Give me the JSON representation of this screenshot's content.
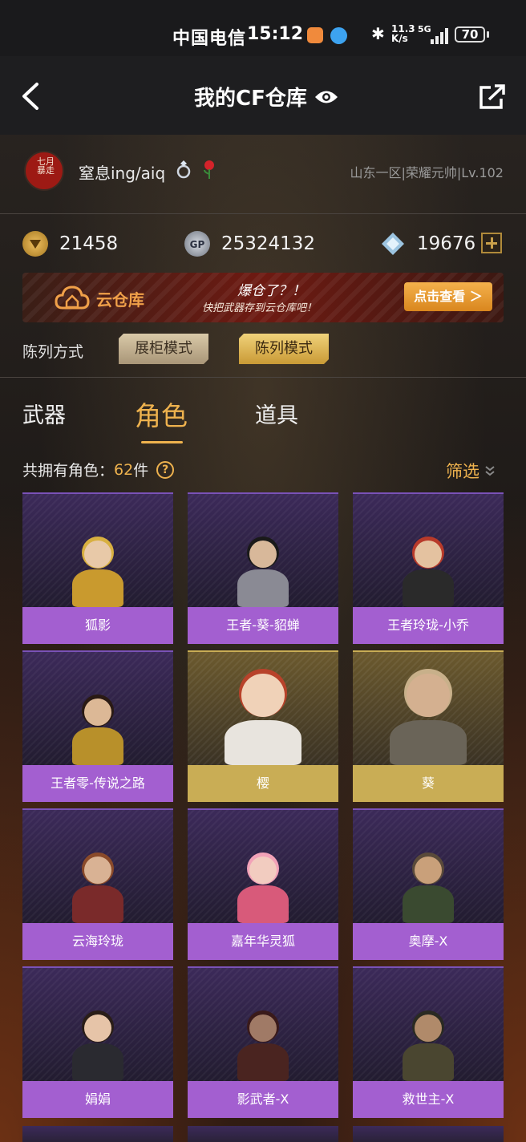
{
  "status_bar": {
    "carrier": "中国电信",
    "time": "15:12",
    "net_speed_value": "11.3",
    "net_speed_unit": "K/s",
    "network": "5G",
    "battery": "70"
  },
  "nav": {
    "title": "我的CF仓库"
  },
  "profile": {
    "username": "窒息ing/aiq",
    "server_rank": "山东一区|荣耀元帅|Lv.102",
    "avatar_text": "七月暴走"
  },
  "currencies": [
    {
      "icon": "cf-coin-icon",
      "value": "21458",
      "color": "#c99a36"
    },
    {
      "icon": "gp-icon",
      "value": "25324132",
      "color": "#8a8f99"
    },
    {
      "icon": "diamond-icon",
      "value": "19676",
      "color": "#7aa6c8"
    }
  ],
  "cloud_banner": {
    "label": "云仓库",
    "slogan_main": "爆仓了？！",
    "slogan_sub": "快把武器存到云仓库吧！",
    "button": "点击查看 ＞"
  },
  "display_mode": {
    "label": "陈列方式",
    "showcase": "展柜模式",
    "list": "陈列模式"
  },
  "tabs": [
    {
      "label": "武器",
      "active": false
    },
    {
      "label": "角色",
      "active": true
    },
    {
      "label": "道具",
      "active": false
    }
  ],
  "count": {
    "prefix": "共拥有角色：",
    "number": "62",
    "suffix": "件",
    "help": "?"
  },
  "filter": {
    "label": "筛选"
  },
  "characters": [
    {
      "name": "狐影",
      "rarity": "purple"
    },
    {
      "name": "王者-葵-貂蝉",
      "rarity": "purple"
    },
    {
      "name": "王者玲珑-小乔",
      "rarity": "purple"
    },
    {
      "name": "王者零-传说之路",
      "rarity": "purple"
    },
    {
      "name": "樱",
      "rarity": "gold"
    },
    {
      "name": "葵",
      "rarity": "gold"
    },
    {
      "name": "云海玲珑",
      "rarity": "purple"
    },
    {
      "name": "嘉年华灵狐",
      "rarity": "purple"
    },
    {
      "name": "奥摩-X",
      "rarity": "purple"
    },
    {
      "name": "娟娟",
      "rarity": "purple"
    },
    {
      "name": "影武者-X",
      "rarity": "purple"
    },
    {
      "name": "救世主-X",
      "rarity": "purple"
    }
  ],
  "colors": {
    "accent": "#eeb24e",
    "purple_card": "#a35fd0",
    "gold_card": "#c9ad55"
  }
}
